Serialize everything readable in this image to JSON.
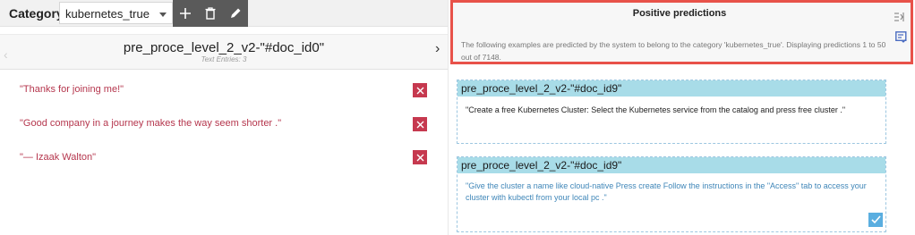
{
  "toolbar": {
    "category_label": "Category:",
    "category_value": "kubernetes_true",
    "tools": [
      "plus-icon",
      "trash-icon",
      "pencil-icon"
    ]
  },
  "document": {
    "title": "pre_proce_level_2_v2-\"#doc_id0\"",
    "subtitle": "Text Entries: 3",
    "entries": [
      "\"Thanks for joining me!\"",
      "\"Good company in a journey makes the way seem shorter .\"",
      "\"— Izaak Walton\""
    ]
  },
  "predictions": {
    "title": "Positive predictions",
    "description": "The following examples are predicted by the system to belong to the category 'kubernetes_true'. Displaying predictions 1 to 50 out of 7148.",
    "cards": [
      {
        "doc": "pre_proce_level_2_v2-\"#doc_id9\"",
        "text": "\"Create a free Kubernetes Cluster: Select the Kubernetes service from the catalog and press free cluster .\""
      },
      {
        "doc": "pre_proce_level_2_v2-\"#doc_id9\"",
        "text": "\"Give the cluster a name like cloud-native Press create Follow the instructions in the \"Access\" tab to access your cluster with kubectl from your local pc .\"",
        "checked": true
      }
    ]
  },
  "colors": {
    "delete_red": "#c6394f",
    "entry_text": "#b5364d",
    "highlight_border": "#e8524a",
    "card_header": "#a8dce8",
    "check_blue": "#5aaee0",
    "accent_icon": "#4b6cc1"
  }
}
